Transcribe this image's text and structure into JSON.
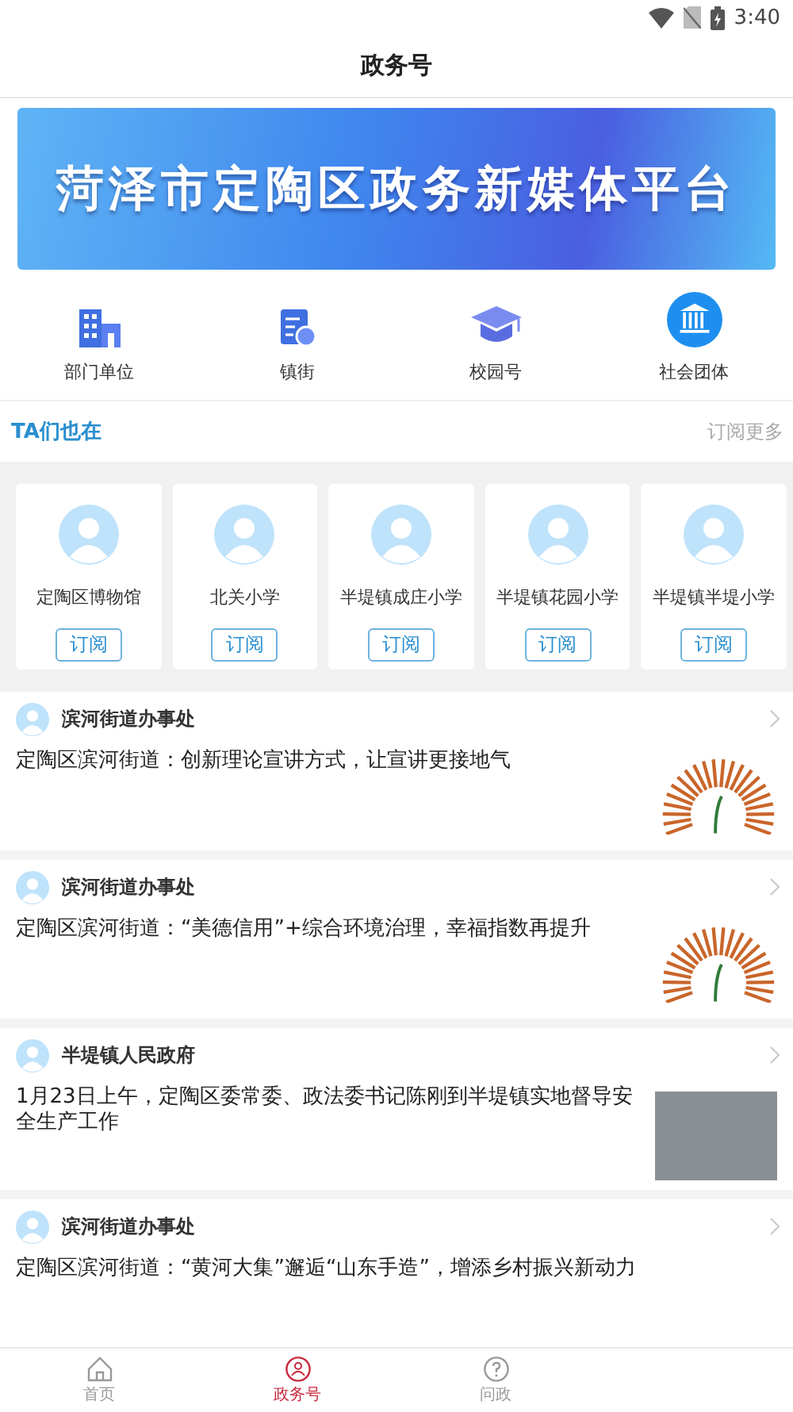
{
  "status_bar": {
    "time": "3:40"
  },
  "header": {
    "title": "政务号"
  },
  "banner": {
    "text": "菏泽市定陶区政务新媒体平台"
  },
  "categories": [
    {
      "label": "部门单位",
      "kind": "building"
    },
    {
      "label": "镇街",
      "kind": "document"
    },
    {
      "label": "校园号",
      "kind": "cap"
    },
    {
      "label": "社会团体",
      "kind": "institution"
    }
  ],
  "recommend": {
    "title": "TA们也在",
    "more": "订阅更多"
  },
  "accounts": [
    {
      "name": "定陶区博物馆",
      "button": "订阅"
    },
    {
      "name": "北关小学",
      "button": "订阅"
    },
    {
      "name": "半堤镇成庄小学",
      "button": "订阅"
    },
    {
      "name": "半堤镇花园小学",
      "button": "订阅"
    },
    {
      "name": "半堤镇半堤小学",
      "button": "订阅"
    }
  ],
  "news": [
    {
      "source": "滨河街道办事处",
      "title": "定陶区滨河街道：创新理论宣讲方式，让宣讲更接地气",
      "kind": "logo"
    },
    {
      "source": "滨河街道办事处",
      "title": "定陶区滨河街道：“美德信用”+综合环境治理，幸福指数再提升",
      "kind": "logo"
    },
    {
      "source": "半堤镇人民政府",
      "title": "1月23日上午，定陶区委常委、政法委书记陈刚到半堤镇实地督导安全生产工作",
      "kind": "photo"
    },
    {
      "source": "滨河街道办事处",
      "title": "定陶区滨河街道：“黄河大集”邂逅“山东手造”，增添乡村振兴新动力",
      "kind": "text"
    }
  ],
  "tabbar": [
    {
      "label": "首页",
      "kind": "home",
      "selected": false
    },
    {
      "label": "政务号",
      "kind": "people",
      "selected": true
    },
    {
      "label": "问政",
      "kind": "question",
      "selected": false
    }
  ]
}
